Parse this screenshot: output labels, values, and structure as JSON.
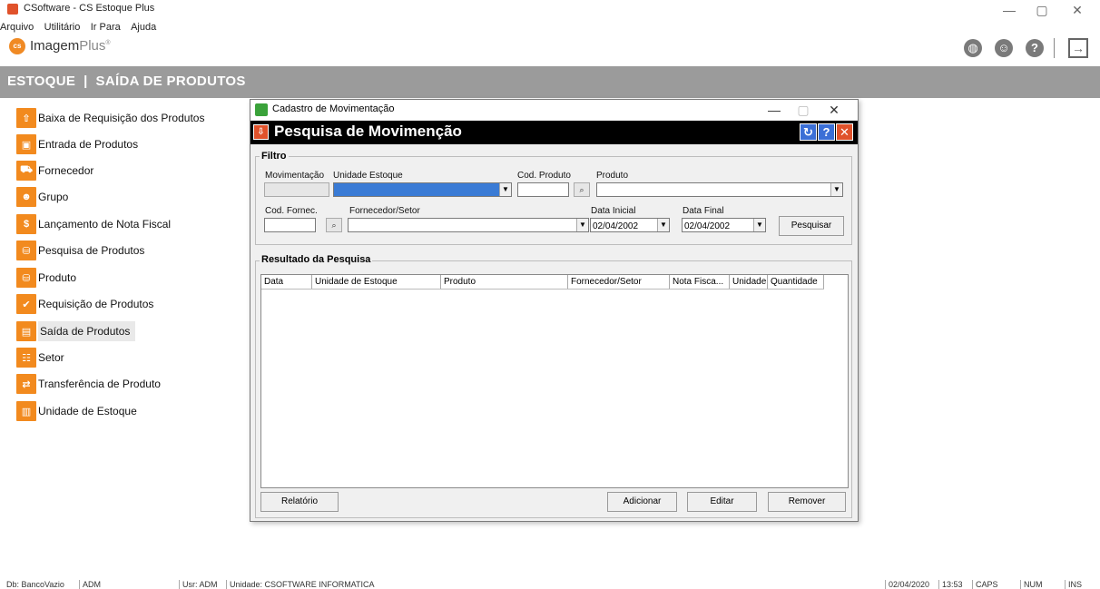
{
  "window": {
    "title": "CSoftware - CS Estoque Plus",
    "controls": {
      "minimize": "—",
      "maximize": "▢",
      "close": "✕"
    }
  },
  "menu": [
    "Arquivo",
    "Utilitário",
    "Ir Para",
    "Ajuda"
  ],
  "logo": {
    "badge": "cs",
    "brand": "Imagem",
    "suffix": "Plus",
    "mark": "®"
  },
  "header": {
    "title": "ESTOQUE  |  SAÍDA DE PRODUTOS"
  },
  "sidebar": {
    "items": [
      {
        "label": "Baixa de Requisição dos Produtos",
        "icon": "upload-box-icon",
        "glyph": "⇧"
      },
      {
        "label": "Entrada de Produtos",
        "icon": "box-in-icon",
        "glyph": "▣"
      },
      {
        "label": "Fornecedor",
        "icon": "truck-icon",
        "glyph": "⛟"
      },
      {
        "label": "Grupo",
        "icon": "group-icon",
        "glyph": "☻"
      },
      {
        "label": "Lançamento de Nota Fiscal",
        "icon": "money-icon",
        "glyph": "$"
      },
      {
        "label": "Pesquisa de Produtos",
        "icon": "database-icon",
        "glyph": "⛁"
      },
      {
        "label": "Produto",
        "icon": "database-icon",
        "glyph": "⛁"
      },
      {
        "label": "Requisição de Produtos",
        "icon": "check-list-icon",
        "glyph": "✔"
      },
      {
        "label": "Saída de Produtos",
        "icon": "box-out-icon",
        "glyph": "▤"
      },
      {
        "label": "Setor",
        "icon": "hierarchy-icon",
        "glyph": "☷"
      },
      {
        "label": "Transferência de Produto",
        "icon": "transfer-icon",
        "glyph": "⇄"
      },
      {
        "label": "Unidade de Estoque",
        "icon": "warehouse-icon",
        "glyph": "▥"
      }
    ],
    "active_index": 8
  },
  "dialog": {
    "window_title": "Cadastro de Movimentação",
    "heading": "Pesquisa de Movimenção",
    "filter": {
      "group_title": "Filtro",
      "movimentacao_label": "Movimentação",
      "movimentacao_value": "",
      "unidade_label": "Unidade Estoque",
      "unidade_value": "",
      "cod_produto_label": "Cod. Produto",
      "cod_produto_value": "",
      "produto_label": "Produto",
      "produto_value": "",
      "cod_fornec_label": "Cod. Fornec.",
      "cod_fornec_value": "",
      "fornecedor_label": "Fornecedor/Setor",
      "fornecedor_value": "",
      "data_inicial_label": "Data Inicial",
      "data_inicial_value": "02/04/2002",
      "data_final_label": "Data Final",
      "data_final_value": "02/04/2002",
      "search_button": "Pesquisar"
    },
    "results": {
      "group_title": "Resultado da Pesquisa",
      "columns": [
        "Data",
        "Unidade de Estoque",
        "Produto",
        "Fornecedor/Setor",
        "Nota Fisca...",
        "Unidade",
        "Quantidade"
      ],
      "rows": []
    },
    "buttons": {
      "report": "Relatório",
      "add": "Adicionar",
      "edit": "Editar",
      "remove": "Remover"
    }
  },
  "statusbar": {
    "db": "Db: BancoVazio",
    "user_short": "ADM",
    "usr": "Usr: ADM",
    "unidade": "Unidade: CSOFTWARE INFORMATICA",
    "date": "02/04/2020",
    "time": "13:53",
    "caps": "CAPS",
    "num": "NUM",
    "ins": "INS"
  }
}
